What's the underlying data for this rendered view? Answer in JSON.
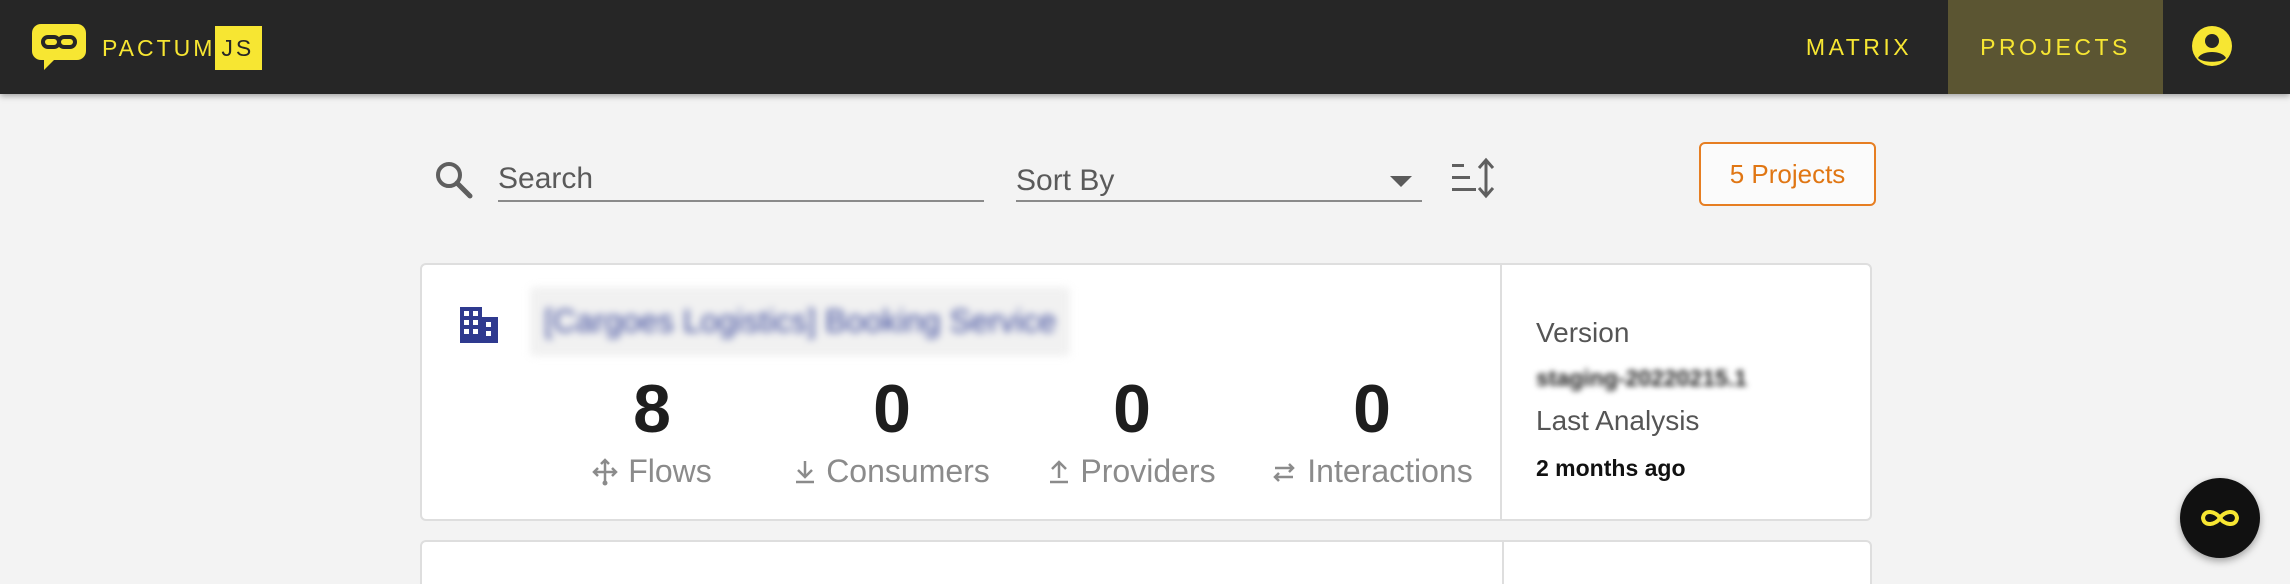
{
  "app": {
    "brand_name": "PACTUM",
    "brand_suffix": "JS",
    "accent_color": "#f7e632"
  },
  "nav": {
    "items": [
      {
        "label": "MATRIX",
        "active": false
      },
      {
        "label": "PROJECTS",
        "active": true
      }
    ],
    "account_icon": "account-circle-icon"
  },
  "toolbar": {
    "search_placeholder": "Search",
    "search_value": "",
    "sort_value": "Sort By",
    "sort_direction_icon": "sort-direction-icon",
    "project_count_label": "5 Projects"
  },
  "projects": [
    {
      "name": "[Cargoes Logistics] Booking Service",
      "icon": "building-icon",
      "stats": [
        {
          "value": "8",
          "label": "Flows",
          "icon": "flows-icon"
        },
        {
          "value": "0",
          "label": "Consumers",
          "icon": "download-icon"
        },
        {
          "value": "0",
          "label": "Providers",
          "icon": "upload-icon"
        },
        {
          "value": "0",
          "label": "Interactions",
          "icon": "swap-icon"
        }
      ],
      "version_label": "Version",
      "version_value": "staging-20220215.1",
      "last_analysis_label": "Last Analysis",
      "last_analysis_value": "2 months ago"
    }
  ],
  "fab": {
    "icon": "infinity-icon"
  }
}
